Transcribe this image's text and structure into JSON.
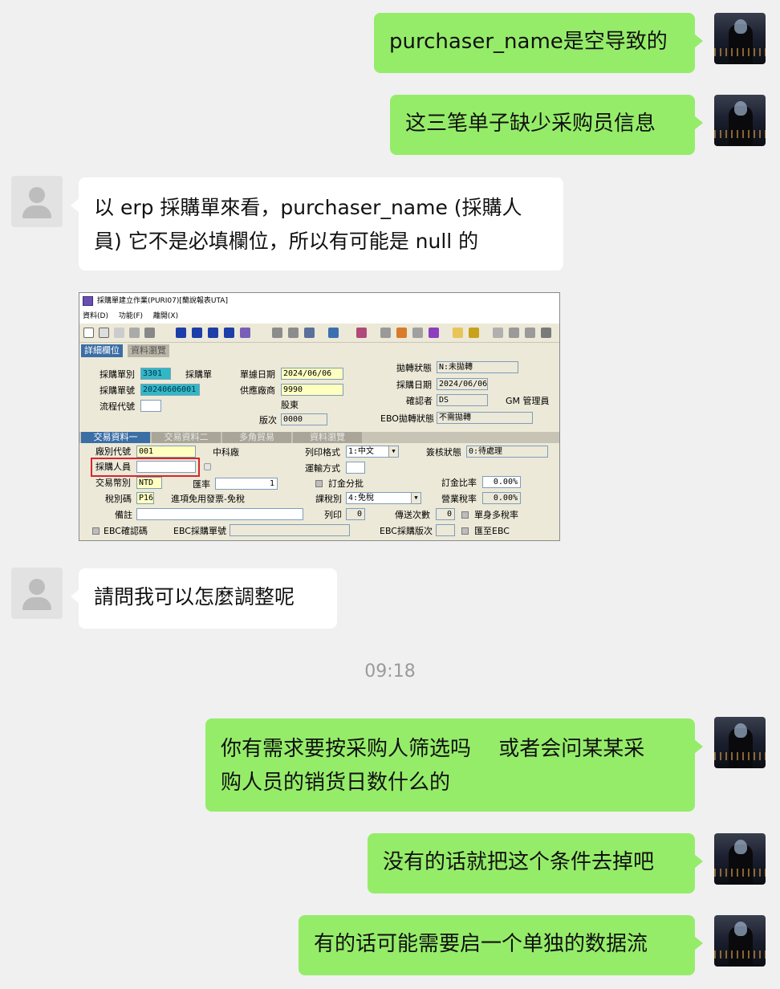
{
  "messages": {
    "m1": {
      "text": "purchaser_name是空导致的"
    },
    "m2": {
      "text": "这三笔单子缺少采购员信息"
    },
    "m3": {
      "line1": "以 erp 採購單來看，purchaser_name (採購人",
      "line2": "員) 它不是必填欄位，所以有可能是 null 的"
    },
    "m5": {
      "text": "請問我可以怎麼調整呢"
    },
    "m6": {
      "line1": "你有需求要按采购人筛选吗　 或者会问某某采",
      "line2": "购人员的销货日数什么的"
    },
    "m7": {
      "text": "没有的话就把这个条件去掉吧"
    },
    "m8": {
      "text": "有的话可能需要启一个单独的数据流"
    }
  },
  "timestamp": "09:18",
  "erp": {
    "window_title": "採購單建立作業(PURI07)[蘭說報表UTA]",
    "menu": [
      "資料(D)",
      "功能(F)",
      "離開(X)"
    ],
    "tabs_top": [
      "詳細欄位",
      "資料瀏覽"
    ],
    "labels": {
      "order_type": "採購單別",
      "order_no": "採購單號",
      "flow_code": "流程代號",
      "doc_date": "單據日期",
      "supplier": "供應廠商",
      "version": "版次",
      "transfer_status": "拋轉狀態",
      "purchase_date": "採購日期",
      "confirmer": "確認者",
      "ebo_status": "EBO拋轉狀態"
    },
    "values": {
      "order_type": "3301",
      "order_type_name": "採購單",
      "order_no": "20240606001",
      "doc_date": "2024/06/06",
      "supplier_code": "9990",
      "supplier_name": "股東",
      "version": "0000",
      "transfer_status": "N:未拋轉",
      "purchase_date": "2024/06/06",
      "confirmer": "DS",
      "confirmer_name": "GM 管理員",
      "ebo_status": "不需拋轉"
    },
    "tabs_mid": [
      "交易資料一",
      "交易資料二",
      "多角貿易",
      "資料瀏覽"
    ],
    "lower": {
      "factory_label": "廠別代號",
      "factory_code": "001",
      "factory_name": "中科廠",
      "purchaser_label": "採購人員",
      "purchaser_value": "",
      "currency_label": "交易幣別",
      "currency": "NTD",
      "rate_label": "匯率",
      "rate": "1",
      "tax_label": "稅別碼",
      "tax_code": "P16",
      "tax_name": "進項免用發票-免稅",
      "note_label": "備註",
      "ebc_confirm": "EBC確認碼",
      "ebc_order": "EBC採購單號",
      "print_label": "列印格式",
      "print_value": "1:中文",
      "shipping_label": "運輸方式",
      "deposit_split": "訂金分批",
      "tax_type_label": "課稅別",
      "tax_type": "4:免稅",
      "print_count_label": "列印",
      "print_count": "0",
      "send_count_label": "傳送次數",
      "send_count": "0",
      "ebc_version": "EBC採購版次",
      "sign_label": "簽核狀態",
      "sign_value": "0:待處理",
      "deposit_rate_label": "訂金比率",
      "deposit_rate": "0.00%",
      "biz_tax_label": "營業稅率",
      "biz_tax": "0.00%",
      "multi_tax": "單身多稅率",
      "to_ebc": "匯至EBC"
    }
  }
}
